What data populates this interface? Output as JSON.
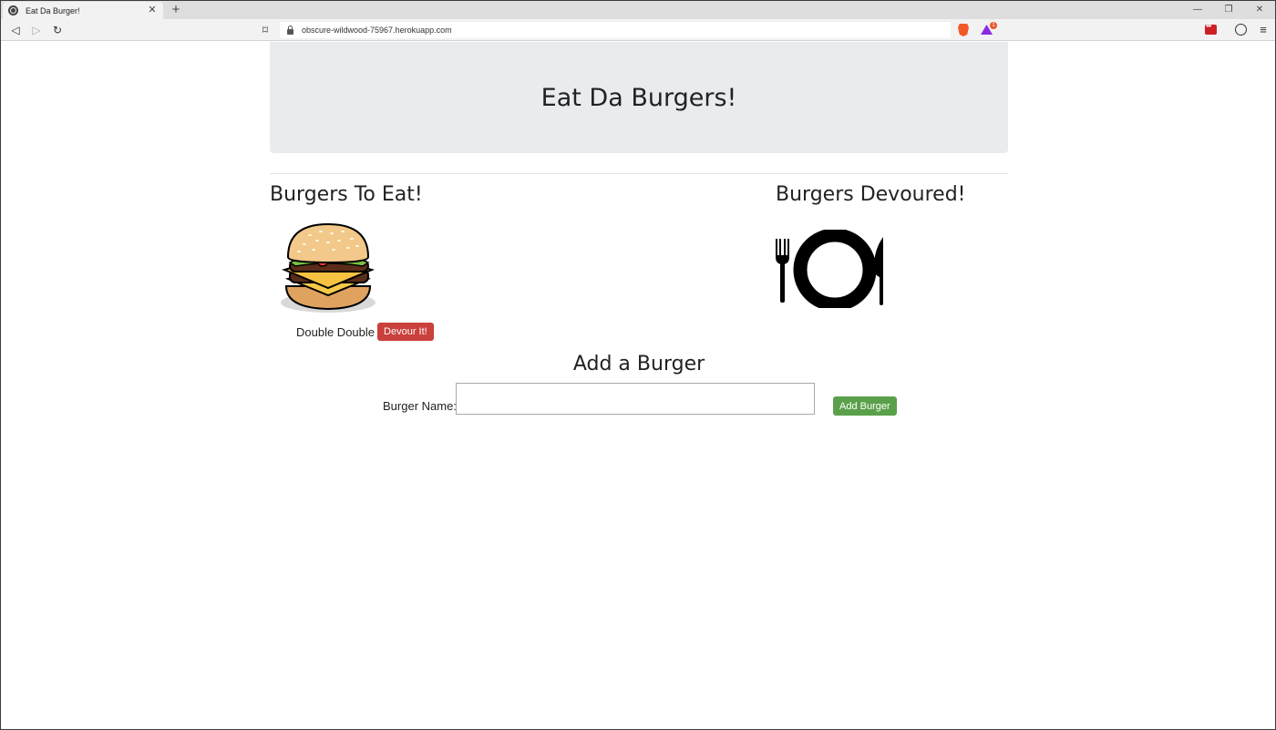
{
  "browser": {
    "tab_title": "Eat Da Burger!",
    "tab_close": "✕",
    "new_tab": "+",
    "url": "obscure-wildwood-75967.herokuapp.com",
    "bat_badge": "1",
    "window_controls": {
      "minimize": "—",
      "restore": "❐",
      "close": "✕"
    },
    "nav": {
      "back": "◁",
      "forward": "▷",
      "reload": "↻",
      "bookmark": "⌑",
      "menu": "≡"
    }
  },
  "page": {
    "header_title": "Eat Da Burgers!",
    "to_eat_title": "Burgers To Eat!",
    "devoured_title": "Burgers Devoured!",
    "burgers_to_eat": [
      {
        "name": "Double Double",
        "button_label": "Devour It!"
      }
    ],
    "add_section_title": "Add a Burger",
    "form": {
      "label": "Burger Name:",
      "input_value": "",
      "submit_label": "Add Burger"
    }
  },
  "colors": {
    "jumbotron_bg": "#e9ecef",
    "devour_button": "#c9403c",
    "add_button": "#5aa04a"
  }
}
